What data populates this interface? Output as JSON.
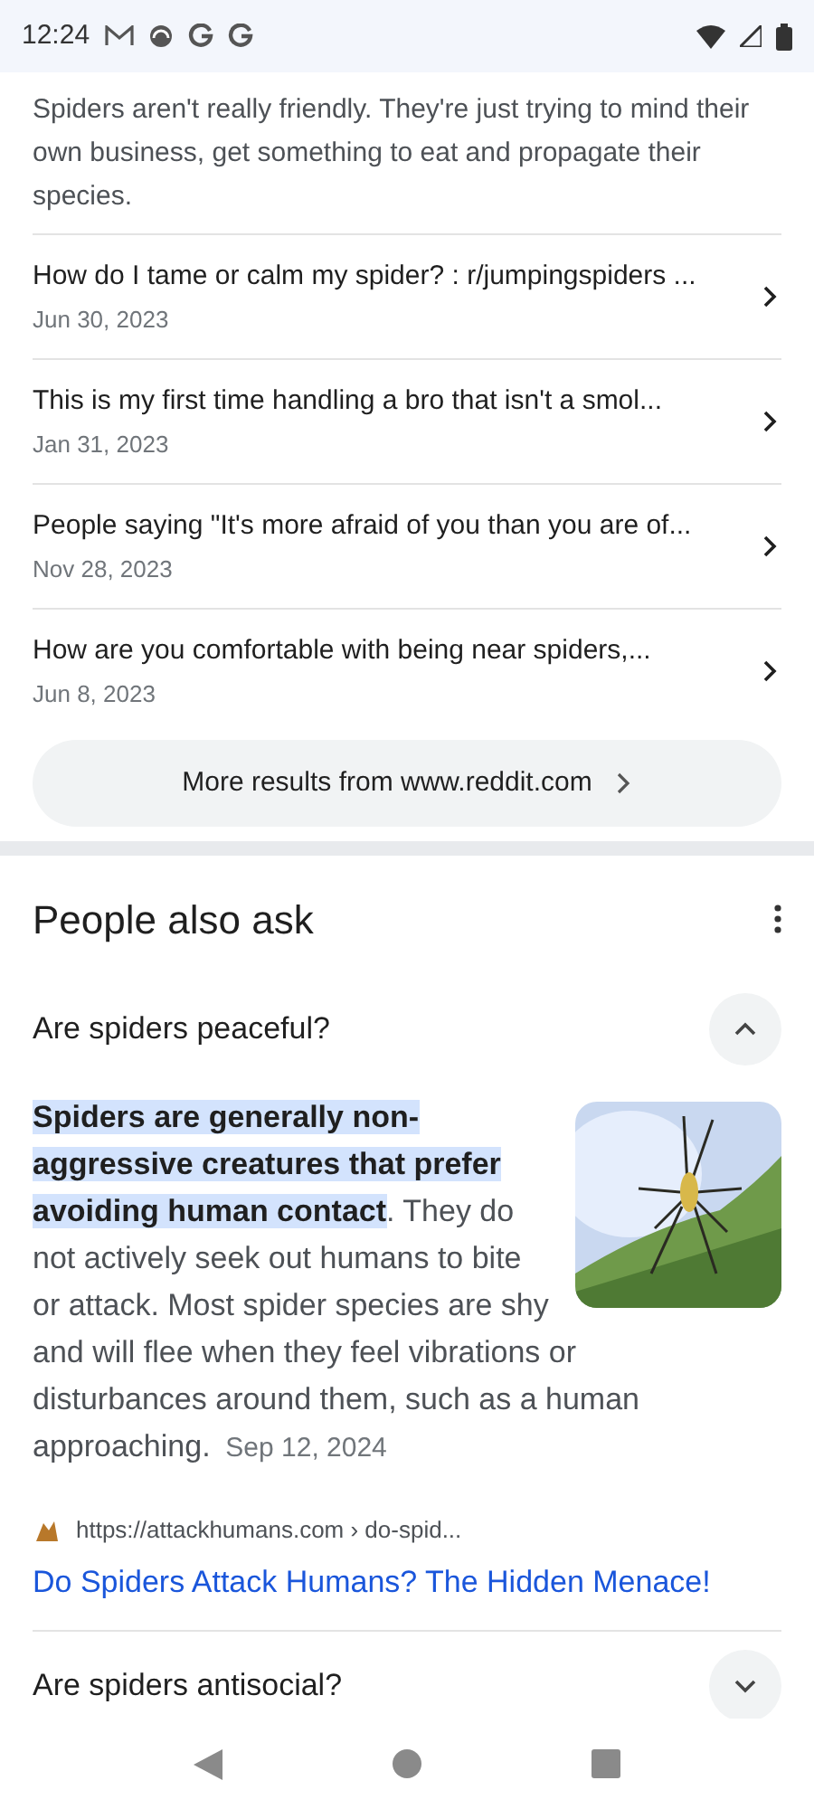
{
  "status_bar": {
    "time": "12:24"
  },
  "snippet": "Spiders aren't really friendly. They're just trying to mind their own business, get something to eat and propagate their species.",
  "results": [
    {
      "title": "How do I tame or calm my spider? : r/jumpingspiders ...",
      "date": "Jun 30, 2023"
    },
    {
      "title": "This is my first time handling a bro that isn't a smol...",
      "date": "Jan 31, 2023"
    },
    {
      "title": "People saying \"It's more afraid of you than you are of...",
      "date": "Nov 28, 2023"
    },
    {
      "title": "How are you comfortable with being near spiders,...",
      "date": "Jun 8, 2023"
    }
  ],
  "more_results": "More results from www.reddit.com",
  "people_also_ask": {
    "title": "People also ask",
    "questions": [
      {
        "question": "Are spiders peaceful?",
        "expanded": true,
        "answer_highlight": "Spiders are generally non-aggressive creatures that prefer avoiding human contact",
        "answer_rest": ". They do not actively seek out humans to bite or attack. Most spider species are shy and will flee when they feel vibrations or disturbances around them, such as a human approaching.",
        "answer_date": "Sep 12, 2024",
        "source_url": "https://attackhumans.com › do-spid...",
        "source_title": "Do Spiders Attack Humans? The Hidden Menace!"
      },
      {
        "question": "Are spiders antisocial?",
        "expanded": false
      }
    ]
  }
}
